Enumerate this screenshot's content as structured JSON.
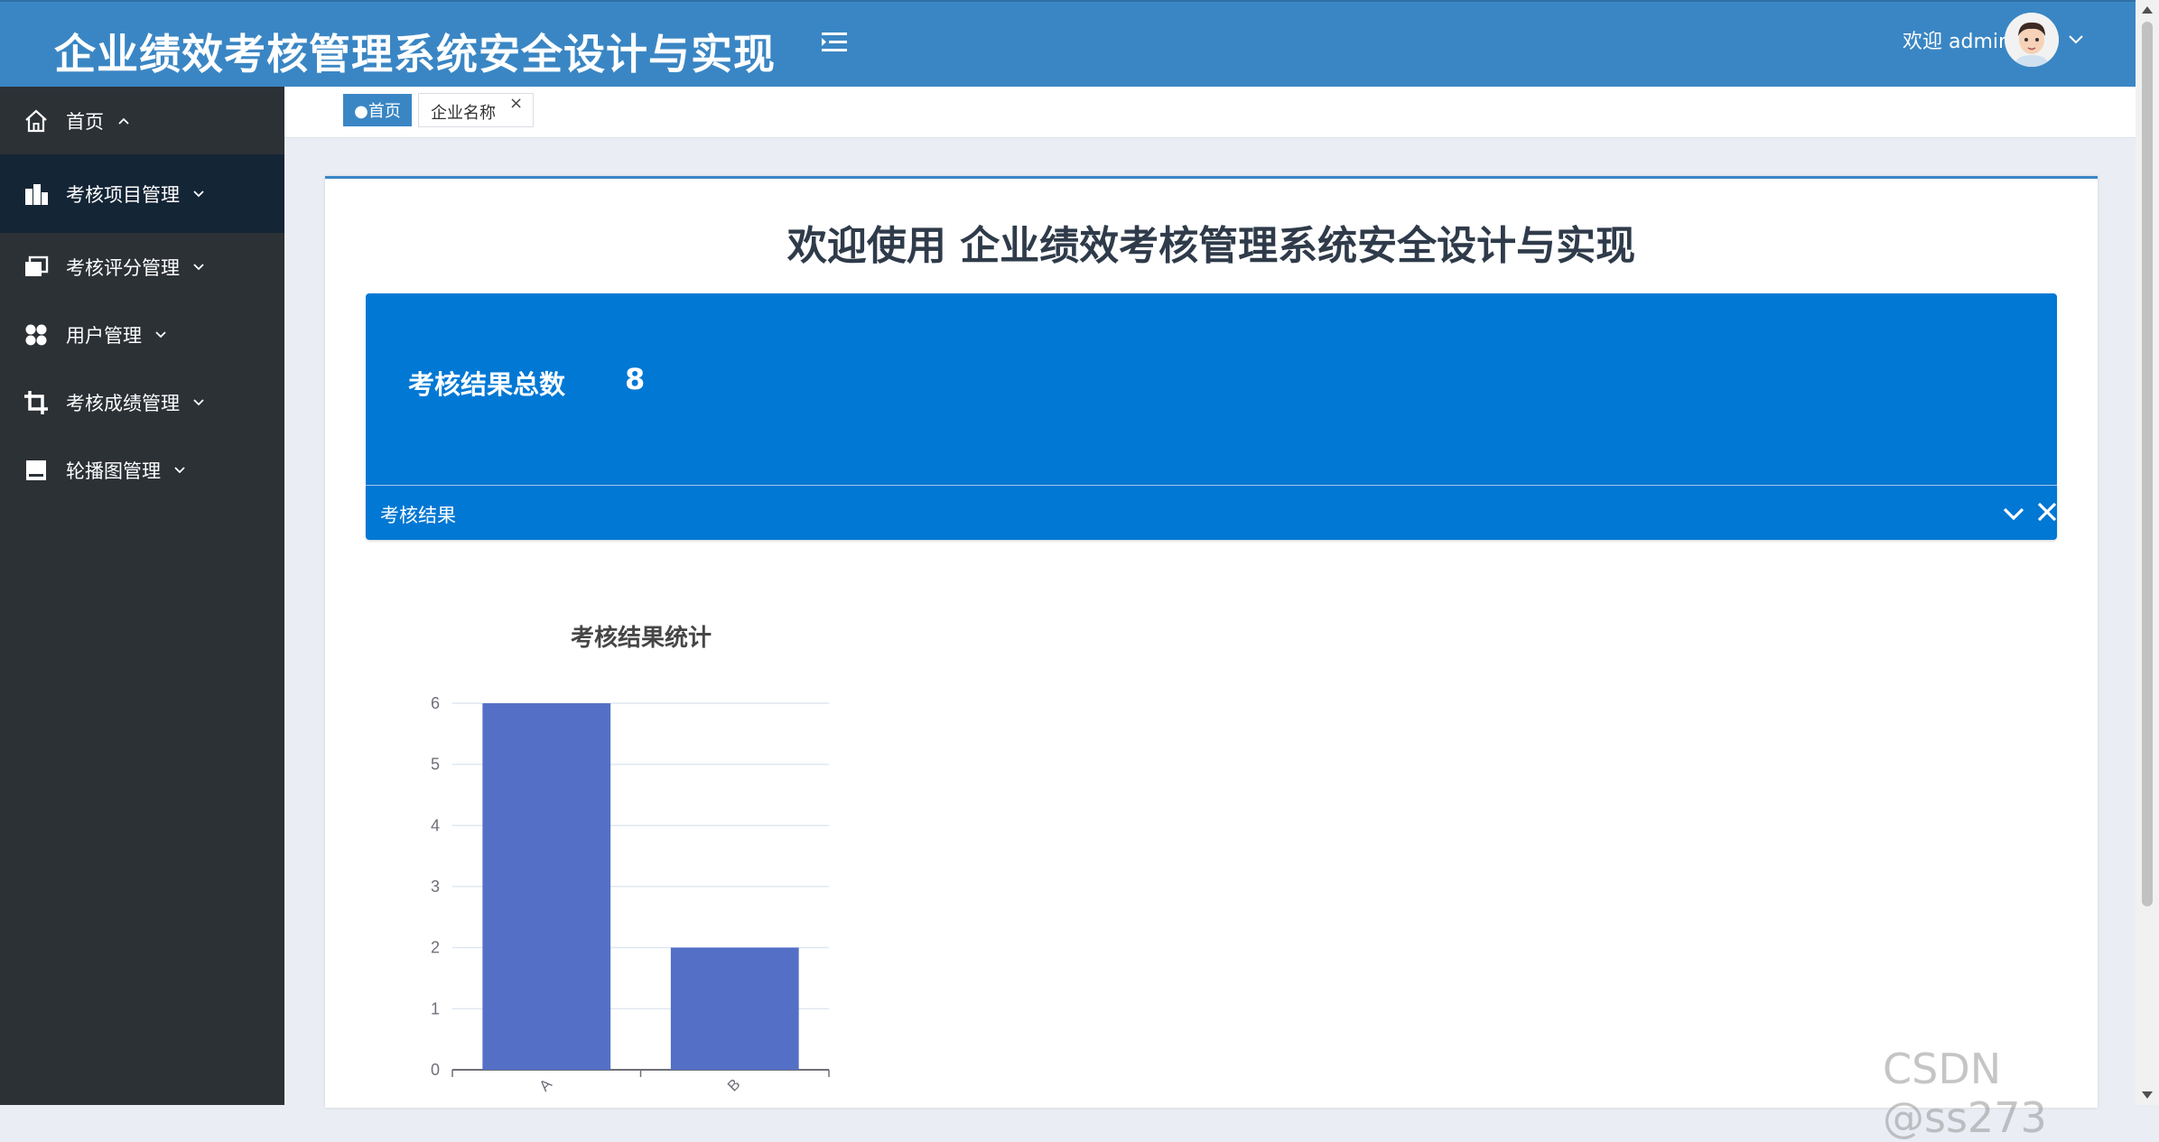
{
  "header": {
    "title": "企业绩效考核管理系统安全设计与实现",
    "welcome": "欢迎 admin"
  },
  "sidebar": {
    "items": [
      {
        "label": "首页",
        "icon": "home-icon"
      },
      {
        "label": "考核项目管理",
        "icon": "building-icon"
      },
      {
        "label": "考核评分管理",
        "icon": "cards-icon"
      },
      {
        "label": "用户管理",
        "icon": "grid-dots-icon"
      },
      {
        "label": "考核成绩管理",
        "icon": "crop-icon"
      },
      {
        "label": "轮播图管理",
        "icon": "image-icon"
      }
    ]
  },
  "tabs": [
    {
      "label": "●首页",
      "active": true
    },
    {
      "label": "企业名称",
      "close": "×"
    }
  ],
  "main": {
    "heading": "欢迎使用 企业绩效考核管理系统安全设计与实现",
    "stat_label": "考核结果总数",
    "stat_value": "8",
    "panel_title": "考核结果"
  },
  "watermark": "CSDN @ss273",
  "colors": {
    "header_bg": "#3a86c4",
    "sidebar_bg": "#2c3136",
    "sidebar_active_bg": "#142536",
    "panel_blue": "#0078d4",
    "bar_color": "#5470c6"
  },
  "chart_data": {
    "type": "bar",
    "title": "考核结果统计",
    "categories": [
      "A",
      "B"
    ],
    "values": [
      6,
      2
    ],
    "ylim": [
      0,
      6
    ],
    "yticks": [
      0,
      1,
      2,
      3,
      4,
      5,
      6
    ],
    "xlabel": "",
    "ylabel": "",
    "grid": true
  }
}
